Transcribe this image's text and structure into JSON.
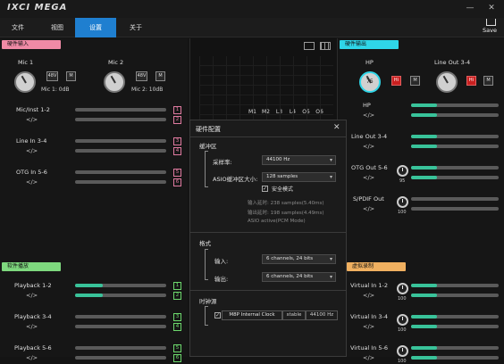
{
  "window": {
    "logo": "IXCI MEGA",
    "minimize": "—",
    "close": "✕",
    "save_label": "Save"
  },
  "menu": [
    {
      "label": "文件"
    },
    {
      "label": "视图"
    },
    {
      "label": "设置"
    },
    {
      "label": "关于"
    }
  ],
  "left": {
    "hw_input_label": "硬件输入",
    "mic1": {
      "name": "Mic 1",
      "value": "Mic 1: 0dB",
      "btn48": "48V",
      "btnM": "M"
    },
    "mic2": {
      "name": "Mic 2",
      "value": "Mic 2: 10dB",
      "btn48": "48V",
      "btnM": "M"
    },
    "channels": [
      {
        "name": "Mic/Inst 1-2",
        "link": "</>",
        "n1": "1",
        "n2": "2",
        "level": 0
      },
      {
        "name": "Line In 3-4",
        "link": "</>",
        "n1": "3",
        "n2": "4",
        "level": 0
      },
      {
        "name": "OTG In 5-6",
        "link": "</>",
        "n1": "5",
        "n2": "6",
        "level": 0
      }
    ],
    "sw_play_label": "软件播放",
    "playback": [
      {
        "name": "Playback 1-2",
        "link": "</>",
        "n1": "1",
        "n2": "2",
        "level": 0.3
      },
      {
        "name": "Playback 3-4",
        "link": "</>",
        "n1": "3",
        "n2": "4",
        "level": 0
      },
      {
        "name": "Playback 5-6",
        "link": "</>",
        "n1": "5",
        "n2": "6",
        "level": 0
      }
    ]
  },
  "mid": {
    "cols": [
      "M1",
      "M2",
      "L3",
      "L4",
      "O5",
      "O6"
    ]
  },
  "right": {
    "hw_output_label": "硬件输出",
    "hp": {
      "name": "HP",
      "value": "75",
      "btnHi": "Hi",
      "btnM": "M"
    },
    "lineout": {
      "name": "Line Out 3-4",
      "btnHi": "Hi",
      "btnM": "M"
    },
    "outputs": [
      {
        "name": "HP",
        "link": "</>",
        "level": 0.3
      },
      {
        "name": "Line Out 3-4",
        "link": "</>",
        "level": 0.3
      },
      {
        "name": "OTG Out 5-6",
        "link": "</>",
        "level": 0.3,
        "knob": "95"
      },
      {
        "name": "S/PDIF Out",
        "link": "</>",
        "level": 0,
        "knob": "100"
      }
    ],
    "virtual_label": "虚拟录制",
    "virtual": [
      {
        "name": "Virtual In 1-2",
        "link": "</>",
        "level": 0.3,
        "knob": "100"
      },
      {
        "name": "Virtual In 3-4",
        "link": "</>",
        "level": 0.3,
        "knob": "100"
      },
      {
        "name": "Virtual In 5-6",
        "link": "</>",
        "level": 0.3,
        "knob": "100"
      }
    ]
  },
  "dialog": {
    "title": "硬件配置",
    "close": "✕",
    "buffer_section": "缓冲区",
    "sample_rate_label": "采样率:",
    "sample_rate_value": "44100 Hz",
    "asio_label": "ASIO缓冲区大小:",
    "asio_value": "128 samples",
    "safe_mode": "安全模式",
    "input_latency": "输入延时: 238 samples(5.40ms)",
    "output_latency": "输出延时: 198 samples(4.49ms)",
    "asio_mode": "ASIO active(PCM Mode)",
    "format_section": "格式",
    "input_label": "输入:",
    "input_value": "6 channels, 24 bits",
    "output_label": "输出:",
    "output_value": "6 channels, 24 bits",
    "clock_section": "时钟源",
    "clock_name": "M8P Internal Clock",
    "clock_status": "stable",
    "clock_rate": "44100 Hz"
  },
  "colors": {
    "accent": "#1f7fd0",
    "meter": "#39c39a",
    "pink": "#e07aa0",
    "cyan": "#2fd6e8",
    "green": "#6cd86c",
    "orange": "#f0b060"
  }
}
